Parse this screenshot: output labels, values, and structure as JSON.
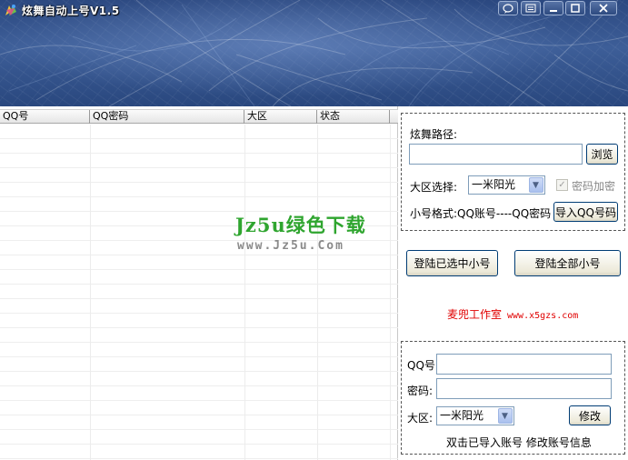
{
  "window": {
    "title": "炫舞自动上号V1.5",
    "controls": [
      "help-icon",
      "menu-icon",
      "minimize-icon",
      "maximize-icon",
      "close-icon"
    ]
  },
  "grid": {
    "columns": [
      "QQ号",
      "QQ密码",
      "大区",
      "状态"
    ],
    "rows": []
  },
  "watermark": {
    "line1": "Jz5u绿色下载",
    "line2": "www.Jz5u.Com"
  },
  "settings": {
    "path_label": "炫舞路径:",
    "path_value": "",
    "browse_label": "浏览",
    "region_label": "大区选择:",
    "region_value": "一米阳光",
    "encrypt_label": "密码加密",
    "encrypt_checked": true,
    "format_label": "小号格式:QQ账号----QQ密码",
    "import_label": "导入QQ号码"
  },
  "actions": {
    "login_selected": "登陆已选中小号",
    "login_all": "登陆全部小号"
  },
  "studio": {
    "name": "麦兜工作室",
    "url": "www.x5gzs.com"
  },
  "edit": {
    "qq_label": "QQ号:",
    "qq_value": "",
    "password_label": "密码:",
    "password_value": "",
    "region_label": "大区:",
    "region_value": "一米阳光",
    "modify_label": "修改",
    "hint": "双击已导入账号 修改账号信息"
  },
  "colors": {
    "banner": "#2f4d87",
    "studio_text": "#e00000",
    "watermark_green": "#2fa52f"
  }
}
